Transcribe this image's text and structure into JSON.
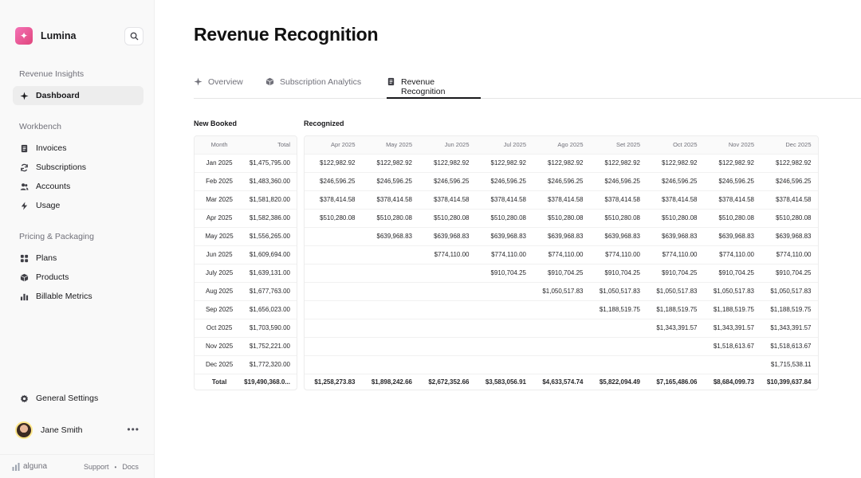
{
  "app": {
    "name": "Lumina"
  },
  "sidebar": {
    "sections": [
      {
        "label": "Revenue Insights"
      },
      {
        "label": "Workbench"
      },
      {
        "label": "Pricing & Packaging"
      }
    ],
    "items": [
      {
        "label": "Dashboard",
        "icon": "sparkle-icon",
        "active": true
      },
      {
        "label": "Invoices",
        "icon": "document-icon"
      },
      {
        "label": "Subscriptions",
        "icon": "refresh-icon"
      },
      {
        "label": "Accounts",
        "icon": "users-icon"
      },
      {
        "label": "Usage",
        "icon": "bolt-icon"
      },
      {
        "label": "Plans",
        "icon": "grid-icon"
      },
      {
        "label": "Products",
        "icon": "box-icon"
      },
      {
        "label": "Billable Metrics",
        "icon": "bar-chart-icon"
      }
    ],
    "settings_label": "General Settings",
    "user": {
      "name": "Jane Smith",
      "more": "•••"
    },
    "footer": {
      "brand": "alguna",
      "support": "Support",
      "dot": "•",
      "docs": "Docs"
    }
  },
  "page": {
    "title": "Revenue Recognition"
  },
  "tabs": [
    {
      "label": "Overview",
      "icon": "sparkle-icon"
    },
    {
      "label": "Subscription Analytics",
      "icon": "box-icon"
    },
    {
      "label": "Revenue Recognition",
      "icon": "document-icon",
      "active": true
    }
  ],
  "booked": {
    "title": "New Booked",
    "headers": {
      "month": "Month",
      "total": "Total"
    },
    "rows": [
      {
        "month": "Jan 2025",
        "total": "$1,475,795.00"
      },
      {
        "month": "Feb 2025",
        "total": "$1,483,360.00"
      },
      {
        "month": "Mar 2025",
        "total": "$1,581,820.00"
      },
      {
        "month": "Apr 2025",
        "total": "$1,582,386.00"
      },
      {
        "month": "May 2025",
        "total": "$1,556,265.00"
      },
      {
        "month": "Jun 2025",
        "total": "$1,609,694.00"
      },
      {
        "month": "July 2025",
        "total": "$1,639,131.00"
      },
      {
        "month": "Aug 2025",
        "total": "$1,677,763.00"
      },
      {
        "month": "Sep 2025",
        "total": "$1,656,023.00"
      },
      {
        "month": "Oct 2025",
        "total": "$1,703,590.00"
      },
      {
        "month": "Nov 2025",
        "total": "$1,752,221.00"
      },
      {
        "month": "Dec 2025",
        "total": "$1,772,320.00"
      }
    ],
    "total_row": {
      "label": "Total",
      "value": "$19,490,368.0..."
    }
  },
  "recognized": {
    "title": "Recognized",
    "columns": [
      "Apr 2025",
      "May 2025",
      "Jun 2025",
      "Jul 2025",
      "Ago 2025",
      "Set 2025",
      "Oct 2025",
      "Nov 2025",
      "Dec 2025"
    ],
    "rows": [
      [
        "$122,982.92",
        "$122,982.92",
        "$122,982.92",
        "$122,982.92",
        "$122,982.92",
        "$122,982.92",
        "$122,982.92",
        "$122,982.92",
        "$122,982.92"
      ],
      [
        "$246,596.25",
        "$246,596.25",
        "$246,596.25",
        "$246,596.25",
        "$246,596.25",
        "$246,596.25",
        "$246,596.25",
        "$246,596.25",
        "$246,596.25"
      ],
      [
        "$378,414.58",
        "$378,414.58",
        "$378,414.58",
        "$378,414.58",
        "$378,414.58",
        "$378,414.58",
        "$378,414.58",
        "$378,414.58",
        "$378,414.58"
      ],
      [
        "$510,280.08",
        "$510,280.08",
        "$510,280.08",
        "$510,280.08",
        "$510,280.08",
        "$510,280.08",
        "$510,280.08",
        "$510,280.08",
        "$510,280.08"
      ],
      [
        "",
        "$639,968.83",
        "$639,968.83",
        "$639,968.83",
        "$639,968.83",
        "$639,968.83",
        "$639,968.83",
        "$639,968.83",
        "$639,968.83"
      ],
      [
        "",
        "",
        "$774,110.00",
        "$774,110.00",
        "$774,110.00",
        "$774,110.00",
        "$774,110.00",
        "$774,110.00",
        "$774,110.00"
      ],
      [
        "",
        "",
        "",
        "$910,704.25",
        "$910,704.25",
        "$910,704.25",
        "$910,704.25",
        "$910,704.25",
        "$910,704.25"
      ],
      [
        "",
        "",
        "",
        "",
        "$1,050,517.83",
        "$1,050,517.83",
        "$1,050,517.83",
        "$1,050,517.83",
        "$1,050,517.83"
      ],
      [
        "",
        "",
        "",
        "",
        "",
        "$1,188,519.75",
        "$1,188,519.75",
        "$1,188,519.75",
        "$1,188,519.75"
      ],
      [
        "",
        "",
        "",
        "",
        "",
        "",
        "$1,343,391.57",
        "$1,343,391.57",
        "$1,343,391.57"
      ],
      [
        "",
        "",
        "",
        "",
        "",
        "",
        "",
        "$1,518,613.67",
        "$1,518,613.67"
      ],
      [
        "",
        "",
        "",
        "",
        "",
        "",
        "",
        "",
        "$1,715,538.11"
      ]
    ],
    "totals": [
      "$1,258,273.83",
      "$1,898,242.66",
      "$2,672,352.66",
      "$3,583,056.91",
      "$4,633,574.74",
      "$5,822,094.49",
      "$7,165,486.06",
      "$8,684,099.73",
      "$10,399,637.84"
    ]
  }
}
